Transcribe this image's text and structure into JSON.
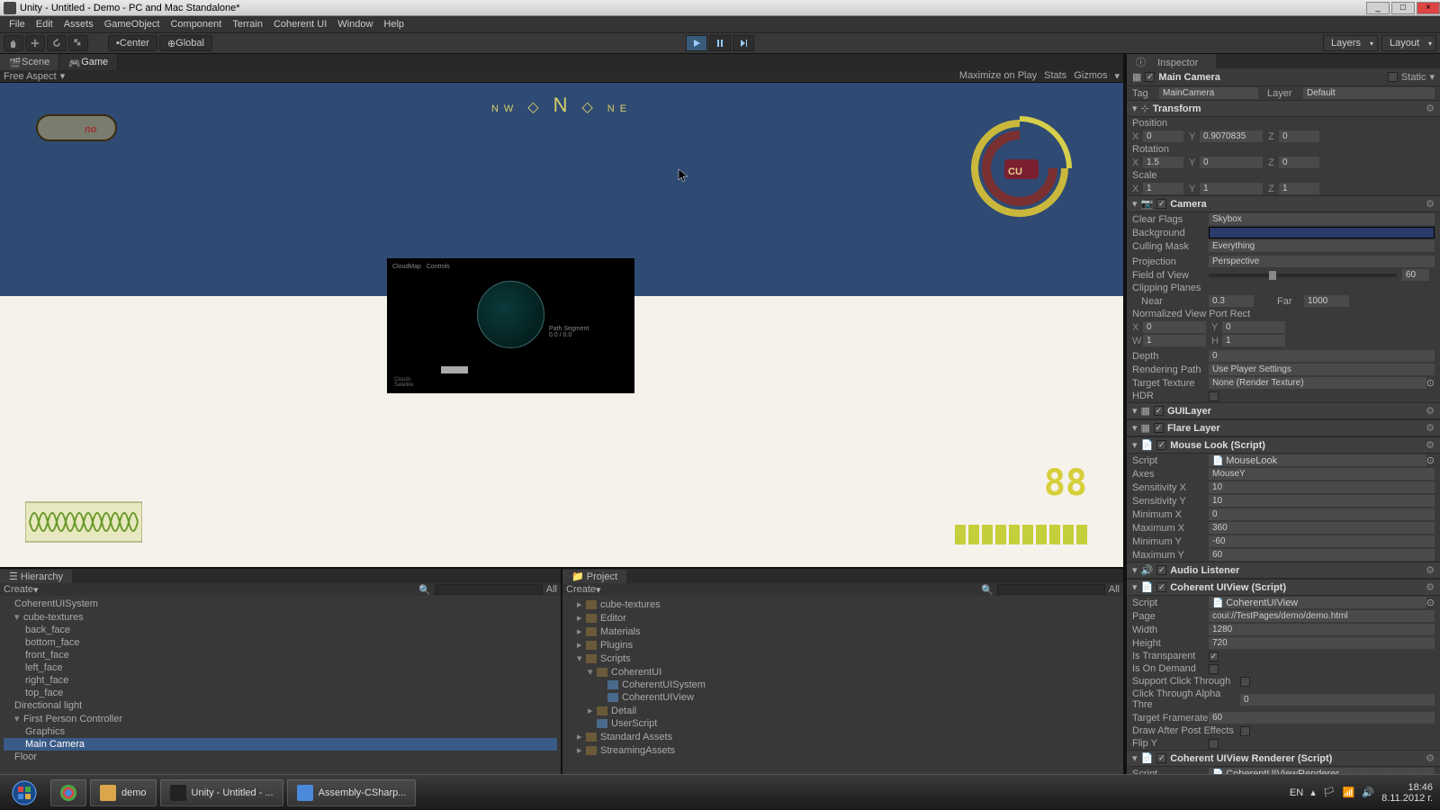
{
  "window": {
    "title": "Unity - Untitled - Demo - PC and Mac Standalone*",
    "minimize": "_",
    "maximize": "□",
    "close": "×"
  },
  "menu": [
    "File",
    "Edit",
    "Assets",
    "GameObject",
    "Component",
    "Terrain",
    "Coherent UI",
    "Window",
    "Help"
  ],
  "toolbar": {
    "pivot": "Center",
    "handle": "Global",
    "layers": "Layers",
    "layout": "Layout"
  },
  "tabs": {
    "scene": "Scene",
    "game": "Game"
  },
  "gameToolbar": {
    "aspect": "Free Aspect",
    "maximize": "Maximize on Play",
    "stats": "Stats",
    "gizmos": "Gizmos"
  },
  "compass": {
    "nw": "NW",
    "n": "N",
    "ne": "NE"
  },
  "hud": {
    "counter": "88",
    "logo": "CU"
  },
  "hierarchy": {
    "title": "Hierarchy",
    "create": "Create",
    "searchAll": "All",
    "items": [
      "CoherentUISystem",
      "cube-textures",
      "back_face",
      "bottom_face",
      "front_face",
      "left_face",
      "right_face",
      "top_face",
      "Directional light",
      "First Person Controller",
      "Graphics",
      "Main Camera",
      "Floor"
    ]
  },
  "project": {
    "title": "Project",
    "create": "Create",
    "searchAll": "All",
    "items": [
      {
        "n": "cube-textures",
        "t": "folder",
        "i": 0
      },
      {
        "n": "Editor",
        "t": "folder",
        "i": 0
      },
      {
        "n": "Materials",
        "t": "folder",
        "i": 0
      },
      {
        "n": "Plugins",
        "t": "folder",
        "i": 0
      },
      {
        "n": "Scripts",
        "t": "folder",
        "i": 0,
        "open": true
      },
      {
        "n": "CoherentUI",
        "t": "folder",
        "i": 1,
        "open": true
      },
      {
        "n": "CoherentUISystem",
        "t": "cs",
        "i": 2
      },
      {
        "n": "CoherentUIView",
        "t": "cs",
        "i": 2
      },
      {
        "n": "Detail",
        "t": "folder",
        "i": 1
      },
      {
        "n": "UserScript",
        "t": "cs",
        "i": 1
      },
      {
        "n": "Standard Assets",
        "t": "folder",
        "i": 0
      },
      {
        "n": "StreamingAssets",
        "t": "folder",
        "i": 0
      }
    ]
  },
  "inspector": {
    "title": "Inspector",
    "objName": "Main Camera",
    "static": "Static",
    "tag": "Tag",
    "tagValue": "MainCamera",
    "layer": "Layer",
    "layerValue": "Default",
    "transform": {
      "title": "Transform",
      "position": "Position",
      "px": "0",
      "py": "0.9070835",
      "pz": "0",
      "rotation": "Rotation",
      "rx": "1.5",
      "ry": "0",
      "rz": "0",
      "scale": "Scale",
      "sx": "1",
      "sy": "1",
      "sz": "1"
    },
    "camera": {
      "title": "Camera",
      "clearFlags": "Clear Flags",
      "clearFlagsV": "Skybox",
      "background": "Background",
      "cullingMask": "Culling Mask",
      "cullingMaskV": "Everything",
      "projection": "Projection",
      "projectionV": "Perspective",
      "fov": "Field of View",
      "fovV": "60",
      "clipping": "Clipping Planes",
      "near": "Near",
      "nearV": "0.3",
      "far": "Far",
      "farV": "1000",
      "viewport": "Normalized View Port Rect",
      "vx": "0",
      "vy": "0",
      "vw": "1",
      "vh": "1",
      "depth": "Depth",
      "depthV": "0",
      "rendering": "Rendering Path",
      "renderingV": "Use Player Settings",
      "targetTex": "Target Texture",
      "targetTexV": "None (Render Texture)",
      "hdr": "HDR"
    },
    "guilayer": "GUILayer",
    "flarelayer": "Flare Layer",
    "mouselook": {
      "title": "Mouse Look (Script)",
      "script": "Script",
      "scriptV": "MouseLook",
      "axes": "Axes",
      "axesV": "MouseY",
      "sensX": "Sensitivity X",
      "sensXV": "10",
      "sensY": "Sensitivity Y",
      "sensYV": "10",
      "minX": "Minimum X",
      "minXV": "0",
      "maxX": "Maximum X",
      "maxXV": "360",
      "minY": "Minimum Y",
      "minYV": "-60",
      "maxY": "Maximum Y",
      "maxYV": "60"
    },
    "audioListener": "Audio Listener",
    "coherentView": {
      "title": "Coherent UIView (Script)",
      "script": "Script",
      "scriptV": "CoherentUIView",
      "page": "Page",
      "pageV": "coui://TestPages/demo/demo.html",
      "width": "Width",
      "widthV": "1280",
      "height": "Height",
      "heightV": "720",
      "isTransparent": "Is Transparent",
      "isOnDemand": "Is On Demand",
      "supportClick": "Support Click Through",
      "clickAlpha": "Click Through Alpha Thre",
      "clickAlphaV": "0",
      "targetFps": "Target Framerate",
      "targetFpsV": "60",
      "drawAfter": "Draw After Post Effects",
      "flipY": "Flip Y"
    },
    "coherentRenderer": {
      "title": "Coherent UIView Renderer (Script)",
      "script": "Script",
      "scriptV": "CoherentUIViewRenderer"
    }
  },
  "taskbar": {
    "items": [
      {
        "label": "",
        "icon": "chrome"
      },
      {
        "label": "demo",
        "icon": "folder"
      },
      {
        "label": "Unity - Untitled - ...",
        "icon": "unity"
      },
      {
        "label": "Assembly-CSharp...",
        "icon": "vs"
      }
    ],
    "lang": "EN",
    "time": "18:46",
    "date": "8.11.2012 г."
  }
}
